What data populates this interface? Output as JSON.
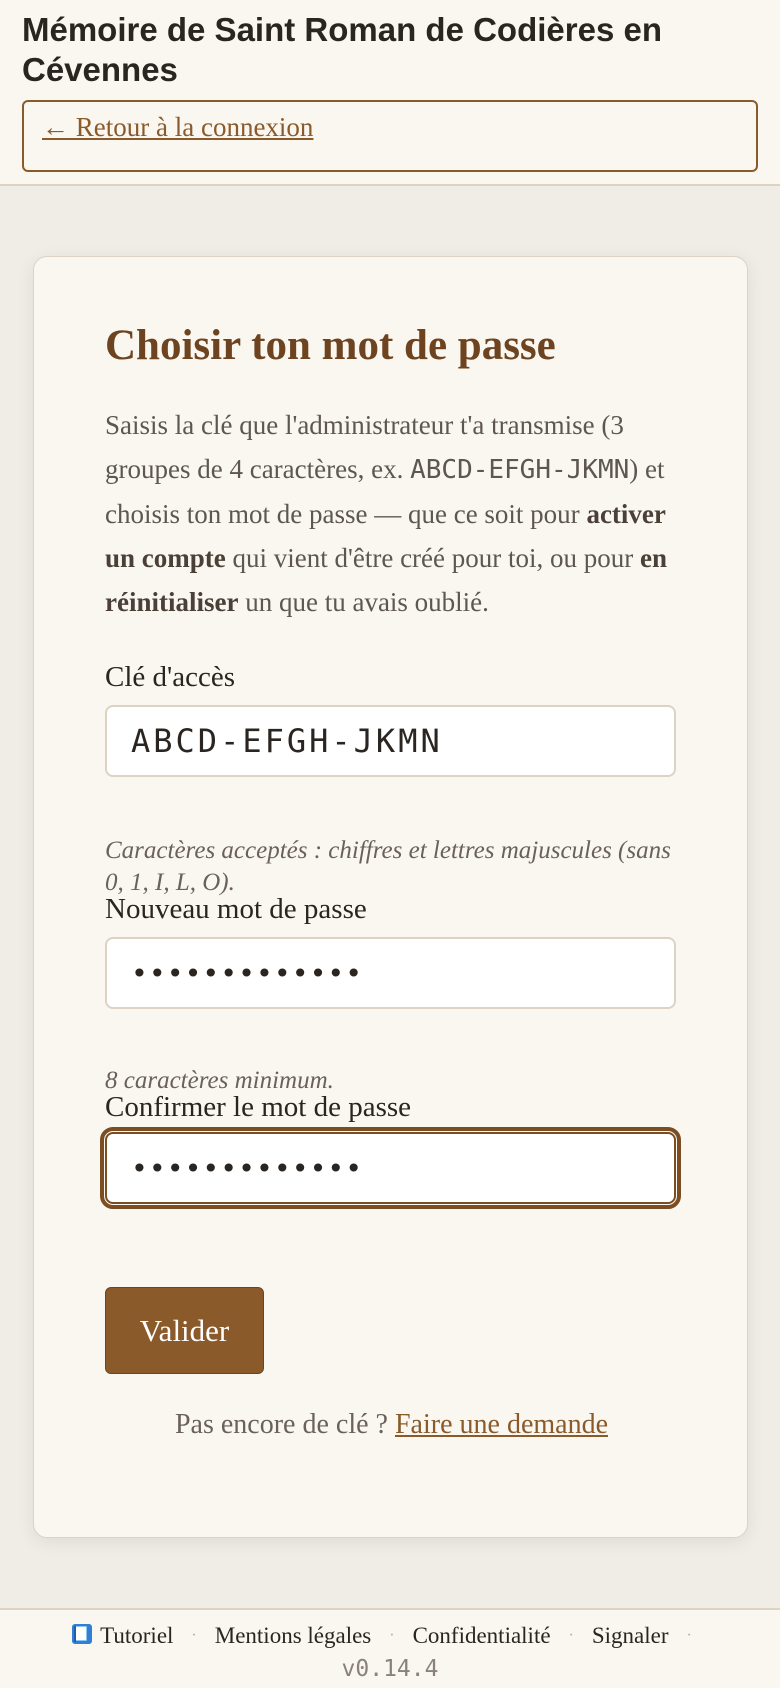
{
  "header": {
    "title": "Mémoire de Saint Roman de Codières en Cévennes",
    "back_link": "← Retour à la connexion"
  },
  "card": {
    "title": "Choisir ton mot de passe",
    "intro": {
      "p1": "Saisis la clé que l'administrateur t'a transmise (3 groupes de 4 caractères, ex. ",
      "example": "ABCD-EFGH-JKMN",
      "p2": ") et choisis ton mot de passe — que ce soit pour ",
      "bold1": "activer un compte",
      "p3": " qui vient d'être créé pour toi, ou pour ",
      "bold2": "en réinitialiser",
      "p4": " un que tu avais oublié."
    },
    "key_field": {
      "label": "Clé d'accès",
      "value": "ABCD-EFGH-JKMN",
      "hint": "Caractères acceptés : chiffres et lettres majuscules (sans 0, 1, I, L, O)."
    },
    "password_field": {
      "label": "Nouveau mot de passe",
      "value": "•••••••••••••",
      "hint": "8 caractères minimum."
    },
    "confirm_field": {
      "label": "Confirmer le mot de passe",
      "value": "•••••••••••••"
    },
    "submit_label": "Valider",
    "request": {
      "text": "Pas encore de clé ? ",
      "link": "Faire une demande"
    }
  },
  "footer": {
    "links": [
      {
        "icon": "book-icon",
        "label": "Tutoriel"
      },
      {
        "label": "Mentions légales"
      },
      {
        "label": "Confidentialité"
      },
      {
        "label": "Signaler"
      }
    ],
    "separator": "·",
    "version": "v0.14.4"
  },
  "colors": {
    "accent": "#8b5a2b",
    "title_brown": "#6e4420",
    "page_bg": "#f0ede6",
    "card_bg": "#faf7f1",
    "border": "#ddd3c2"
  }
}
